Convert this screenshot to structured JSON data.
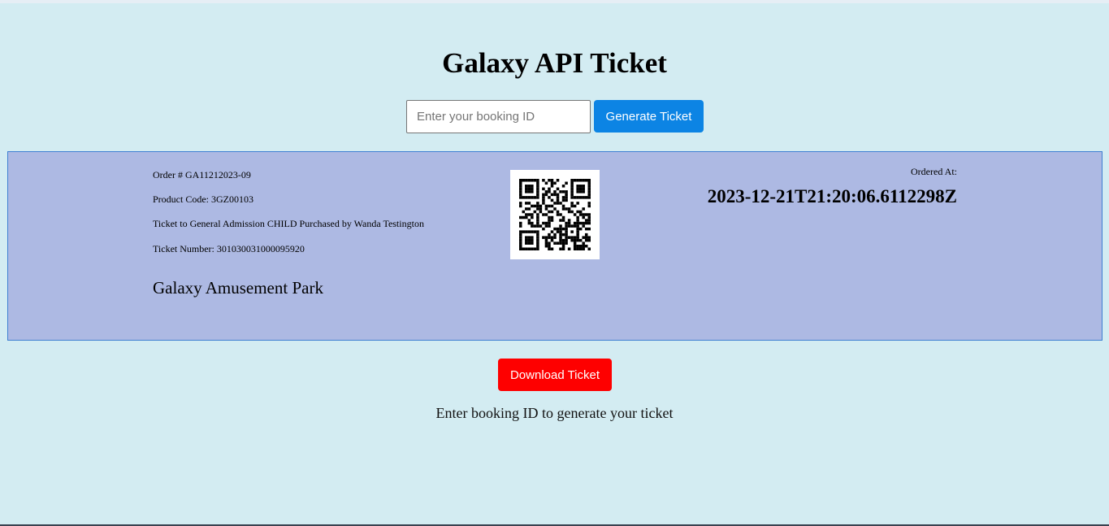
{
  "page": {
    "title": "Galaxy API Ticket"
  },
  "booking_form": {
    "input_value": "",
    "input_placeholder": "Enter your booking ID",
    "generate_label": "Generate Ticket"
  },
  "ticket": {
    "order": "Order # GA11212023-09",
    "product_code": "Product Code: 3GZ00103",
    "description": "Ticket to General Admission CHILD Purchased by Wanda Testington",
    "ticket_number": "Ticket Number: 301030031000095920",
    "park_name": "Galaxy Amusement Park",
    "ordered_at_label": "Ordered At:",
    "ordered_at_value": "2023-12-21T21:20:06.6112298Z",
    "qr_icon": "qr-code-icon"
  },
  "actions": {
    "download_label": "Download Ticket"
  },
  "status": {
    "hint": "Enter booking ID to generate your ticket"
  },
  "colors": {
    "background": "#d3ecf2",
    "ticket_background": "#adb9e3",
    "ticket_border": "#3f7fd2",
    "primary_button": "#0c84e4",
    "download_button": "#fe0000"
  }
}
